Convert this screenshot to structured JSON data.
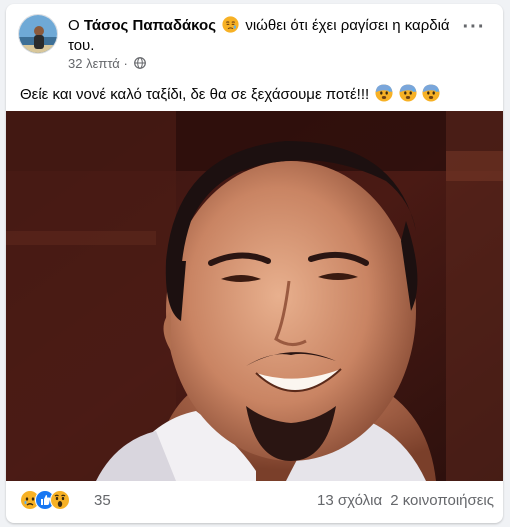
{
  "post": {
    "prefix": "Ο",
    "author": "Τάσος Παπαδάκος",
    "feeling_text": "νιώθει ότι έχει ραγίσει η καρδιά του.",
    "feeling_icon": "sad-face-emoji",
    "timestamp": "32 λεπτά",
    "audience_icon": "globe-icon",
    "more_label": "···",
    "body_text": "Θείε και νονέ καλό ταξίδι, δε θα σε ξεχάσουμε ποτέ!!!",
    "body_emojis": [
      "anxious-face-emoji",
      "anxious-face-emoji",
      "anxious-face-emoji"
    ],
    "photo_alt": "photo of smiling man with goatee"
  },
  "footer": {
    "reaction_icons": [
      "sad-reaction-icon",
      "like-reaction-icon",
      "wow-reaction-icon"
    ],
    "reaction_count": "35",
    "comments": "13 σχόλια",
    "shares": "2 κοινοποιήσεις"
  },
  "colors": {
    "text_primary": "#050505",
    "text_secondary": "#65676b",
    "like_blue": "#1877f2",
    "reaction_yellow": "#f7b125"
  }
}
